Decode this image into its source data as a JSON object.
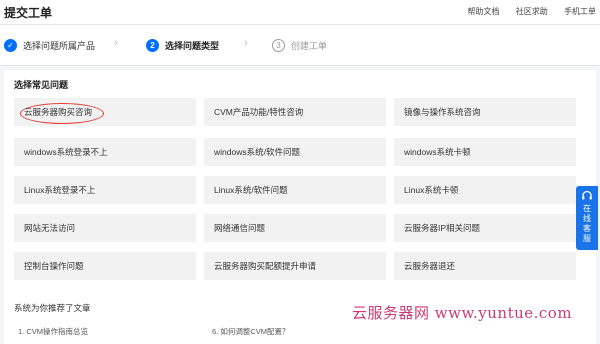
{
  "header": {
    "title": "提交工单",
    "links": [
      "帮助文档",
      "社区求助",
      "手机工单"
    ]
  },
  "steps": [
    {
      "number": "✓",
      "label": "选择问题所属产品",
      "state": "done"
    },
    {
      "number": "2",
      "label": "选择问题类型",
      "state": "active"
    },
    {
      "number": "3",
      "label": "创建工单",
      "state": "pending"
    }
  ],
  "main": {
    "section_title": "选择常见问题",
    "faq_tiles": [
      [
        "云服务器购买咨询",
        "CVM产品功能/特性咨询",
        "镜像与操作系统咨询"
      ],
      [
        "windows系统登录不上",
        "windows系统/软件问题",
        "windows系统卡顿"
      ],
      [
        "Linux系统登录不上",
        "Linux系统/软件问题",
        "Linux系统卡顿"
      ],
      [
        "网站无法访问",
        "网络通信问题",
        "云服务器IP相关问题"
      ],
      [
        "控制台操作问题",
        "云服务器购买配额提升申请",
        "云服务器退还"
      ]
    ],
    "recommend_title": "系统为你推荐了文章",
    "recommend_items": [
      "1. CVM操作指南总览",
      "6. 如何调整CVM配置？"
    ]
  },
  "float_button": {
    "label": "在线客服",
    "icon": "headset-icon"
  },
  "watermark": "云服务器网 www.yuntue.com",
  "colors": {
    "accent": "#006eff",
    "highlight": "#e53935",
    "tile_bg": "#f2f2f2",
    "watermark": "#c2185b"
  }
}
